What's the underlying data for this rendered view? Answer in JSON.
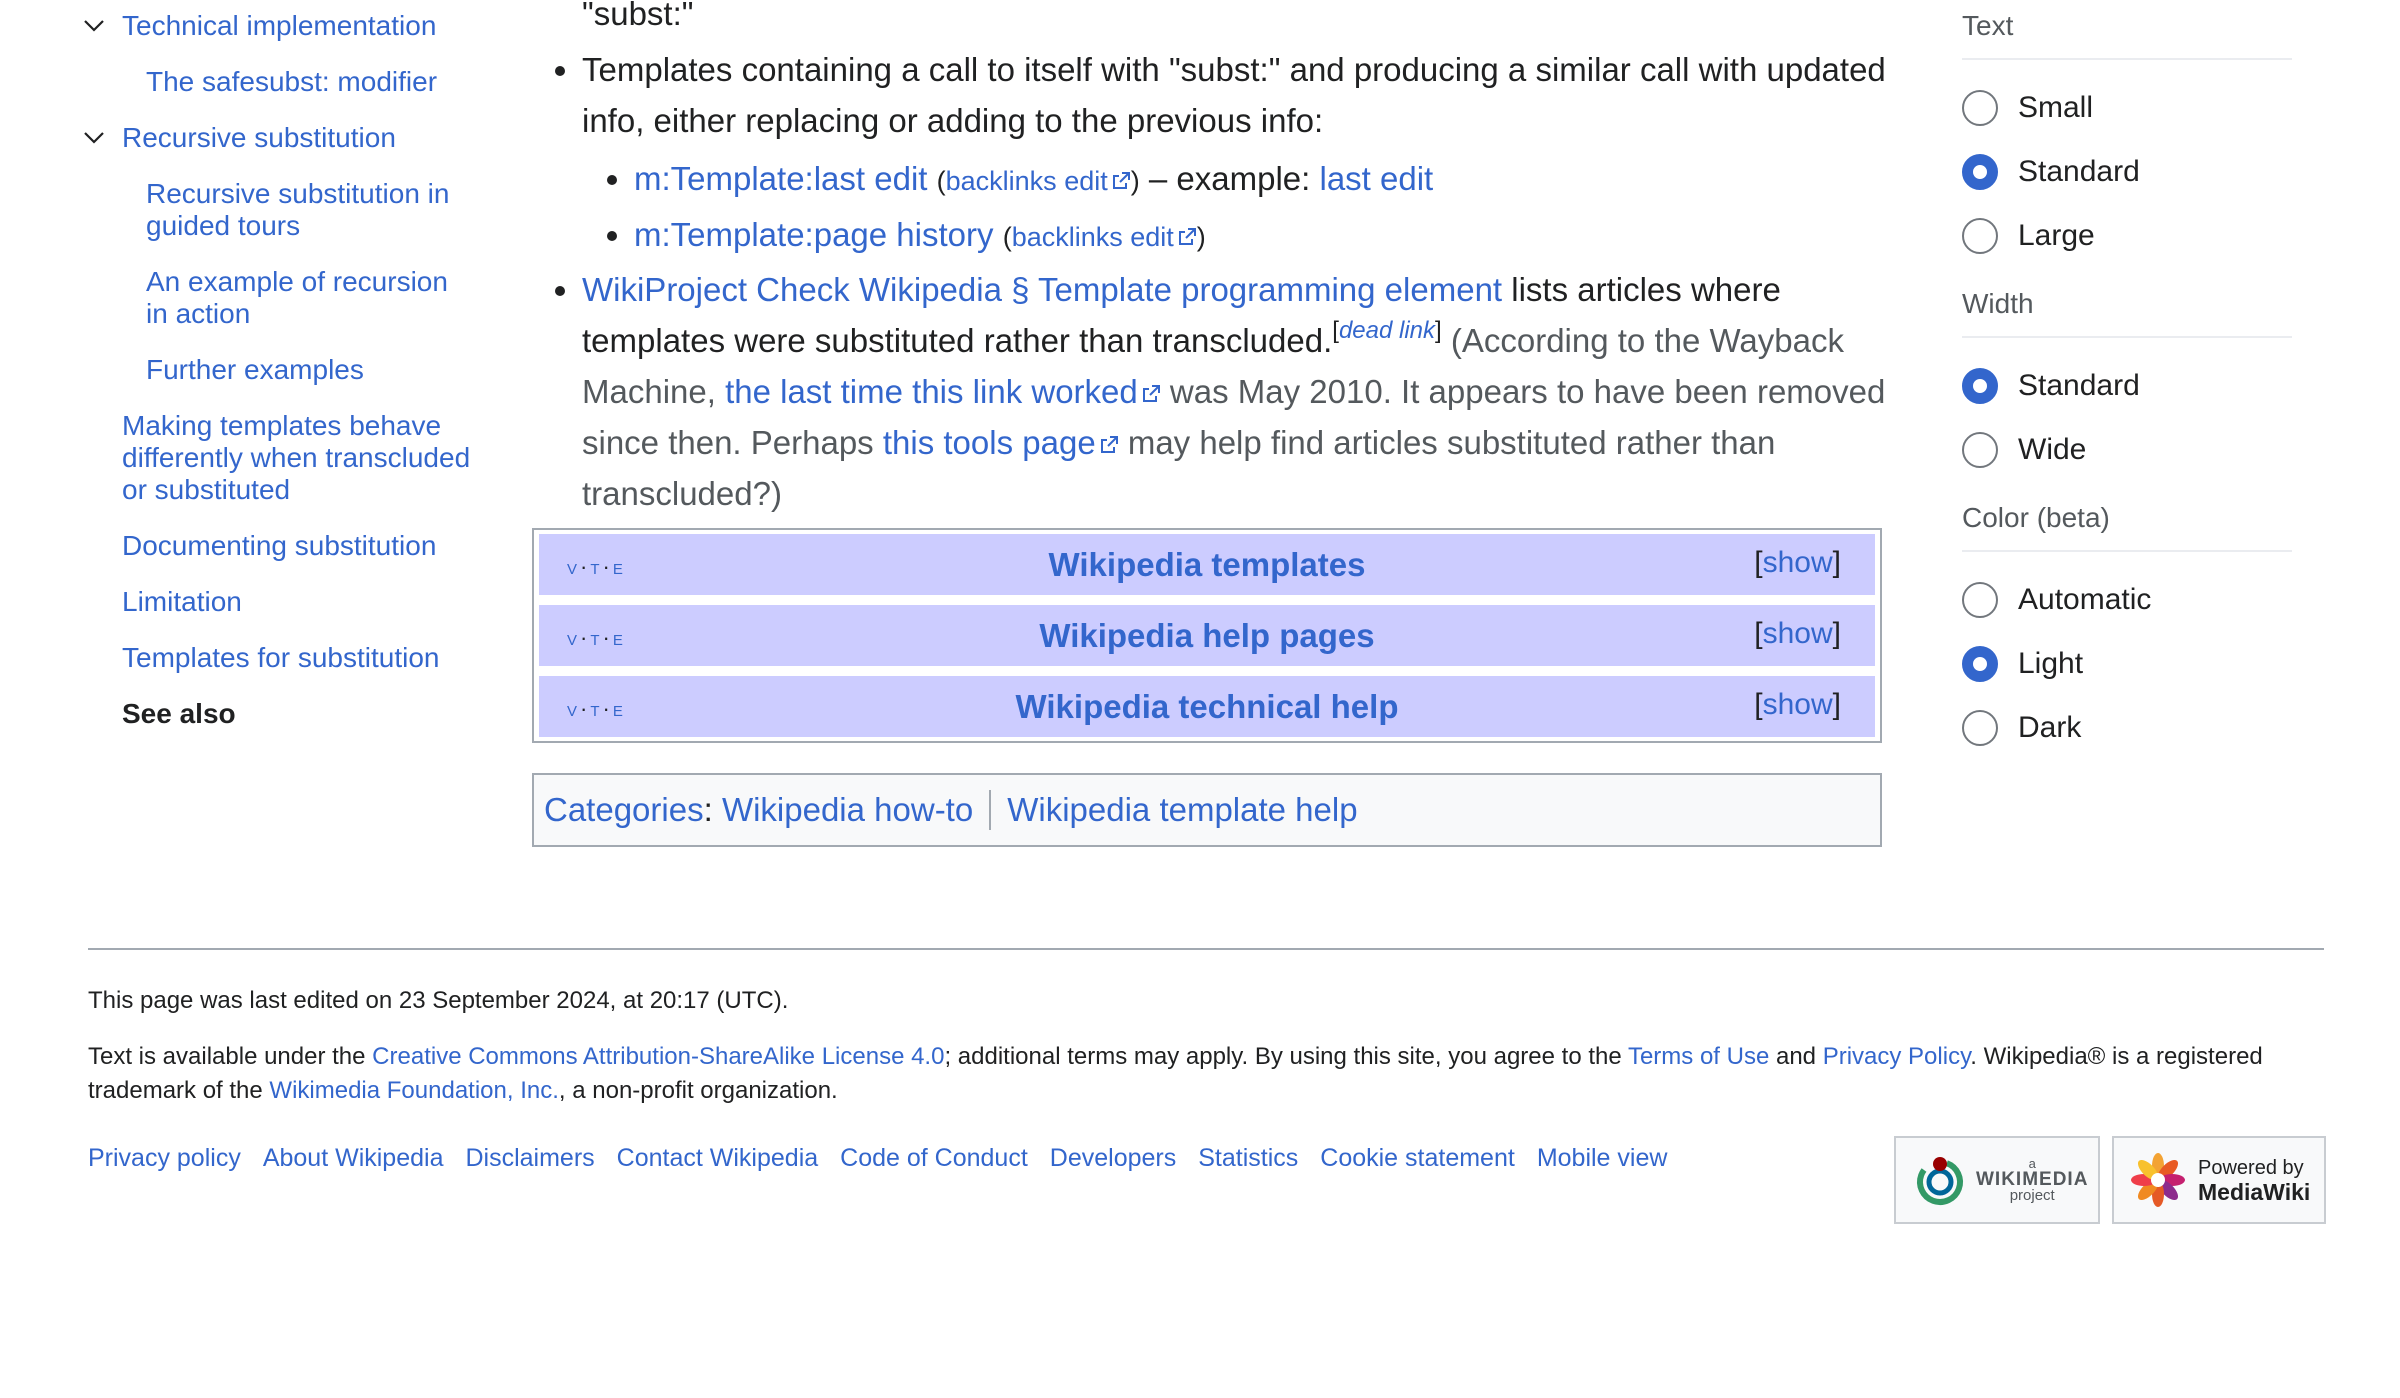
{
  "toc": {
    "items": [
      {
        "level": 1,
        "label": "Technical implementation",
        "chevron": true
      },
      {
        "level": 2,
        "label": "The safesubst: modifier"
      },
      {
        "level": 1,
        "label": "Recursive substitution",
        "chevron": true
      },
      {
        "level": 2,
        "label": "Recursive substitution in guided tours"
      },
      {
        "level": 2,
        "label": "An example of recursion in action"
      },
      {
        "level": 2,
        "label": "Further examples"
      },
      {
        "level": 1,
        "label": "Making templates behave differently when transcluded or substituted"
      },
      {
        "level": 1,
        "label": "Documenting substitution"
      },
      {
        "level": 1,
        "label": "Limitation"
      },
      {
        "level": 1,
        "label": "Templates for substitution"
      },
      {
        "level": 1,
        "label": "See also",
        "current": true
      }
    ]
  },
  "content": {
    "top_fragment": "\"subst:\"",
    "bullet1_text": "Templates containing a call to itself with \"subst:\" and producing a similar call with updated info, either replacing or adding to the previous info:",
    "sub1_link": "m:Template:last edit",
    "sub1_backlinks": "backlinks edit",
    "sub1_mid": " – example: ",
    "sub1_example": "last edit",
    "sub2_link": "m:Template:page history",
    "sub2_backlinks": "backlinks edit",
    "bullet2_link": "WikiProject Check Wikipedia § Template programming element",
    "bullet2_text": " lists articles where templates were substituted rather than transcluded.",
    "dead_link": "dead link",
    "bullet2_note1": " (According to the Wayback Machine, ",
    "bullet2_link2": "the last time this link worked",
    "bullet2_note2": " was May 2010. It appears to have been removed since then. Perhaps ",
    "bullet2_link3": "this tools page",
    "bullet2_note3": " may help find articles substituted rather than transcluded?)"
  },
  "navboxes": [
    {
      "vte": [
        "v",
        "t",
        "e"
      ],
      "title": "Wikipedia templates",
      "show": "show"
    },
    {
      "vte": [
        "v",
        "t",
        "e"
      ],
      "title": "Wikipedia help pages",
      "show": "show"
    },
    {
      "vte": [
        "v",
        "t",
        "e"
      ],
      "title": "Wikipedia technical help",
      "show": "show"
    }
  ],
  "categories": {
    "label": "Categories",
    "items": [
      "Wikipedia how-to",
      "Wikipedia template help"
    ]
  },
  "panel": {
    "groups": [
      {
        "heading": "Text",
        "options": [
          {
            "label": "Small",
            "checked": false
          },
          {
            "label": "Standard",
            "checked": true
          },
          {
            "label": "Large",
            "checked": false
          }
        ]
      },
      {
        "heading": "Width",
        "options": [
          {
            "label": "Standard",
            "checked": true
          },
          {
            "label": "Wide",
            "checked": false
          }
        ]
      },
      {
        "heading": "Color (beta)",
        "options": [
          {
            "label": "Automatic",
            "checked": false
          },
          {
            "label": "Light",
            "checked": true
          },
          {
            "label": "Dark",
            "checked": false
          }
        ]
      }
    ]
  },
  "footer": {
    "last_edited": "This page was last edited on 23 September 2024, at 20:17 (UTC).",
    "license_pre": "Text is available under the ",
    "license_link": "Creative Commons Attribution-ShareAlike License 4.0",
    "license_mid": "; additional terms may apply. By using this site, you agree to the ",
    "terms_link": "Terms of Use",
    "and": " and ",
    "privacy_link": "Privacy Policy",
    "license_post": ". Wikipedia® is a registered trademark of the ",
    "foundation_link": "Wikimedia Foundation, Inc.",
    "license_end": ", a non-profit organization.",
    "links": [
      "Privacy policy",
      "About Wikipedia",
      "Disclaimers",
      "Contact Wikipedia",
      "Code of Conduct",
      "Developers",
      "Statistics",
      "Cookie statement",
      "Mobile view"
    ],
    "badge_wm": {
      "small": "a",
      "name": "WIKIMEDIA",
      "sub": "project"
    },
    "badge_mw": {
      "top": "Powered by",
      "name": "MediaWiki"
    }
  },
  "colors": {
    "link": "#3366cc",
    "navbox": "#ccccff",
    "border": "#a2a9b1",
    "text": "#202122"
  }
}
